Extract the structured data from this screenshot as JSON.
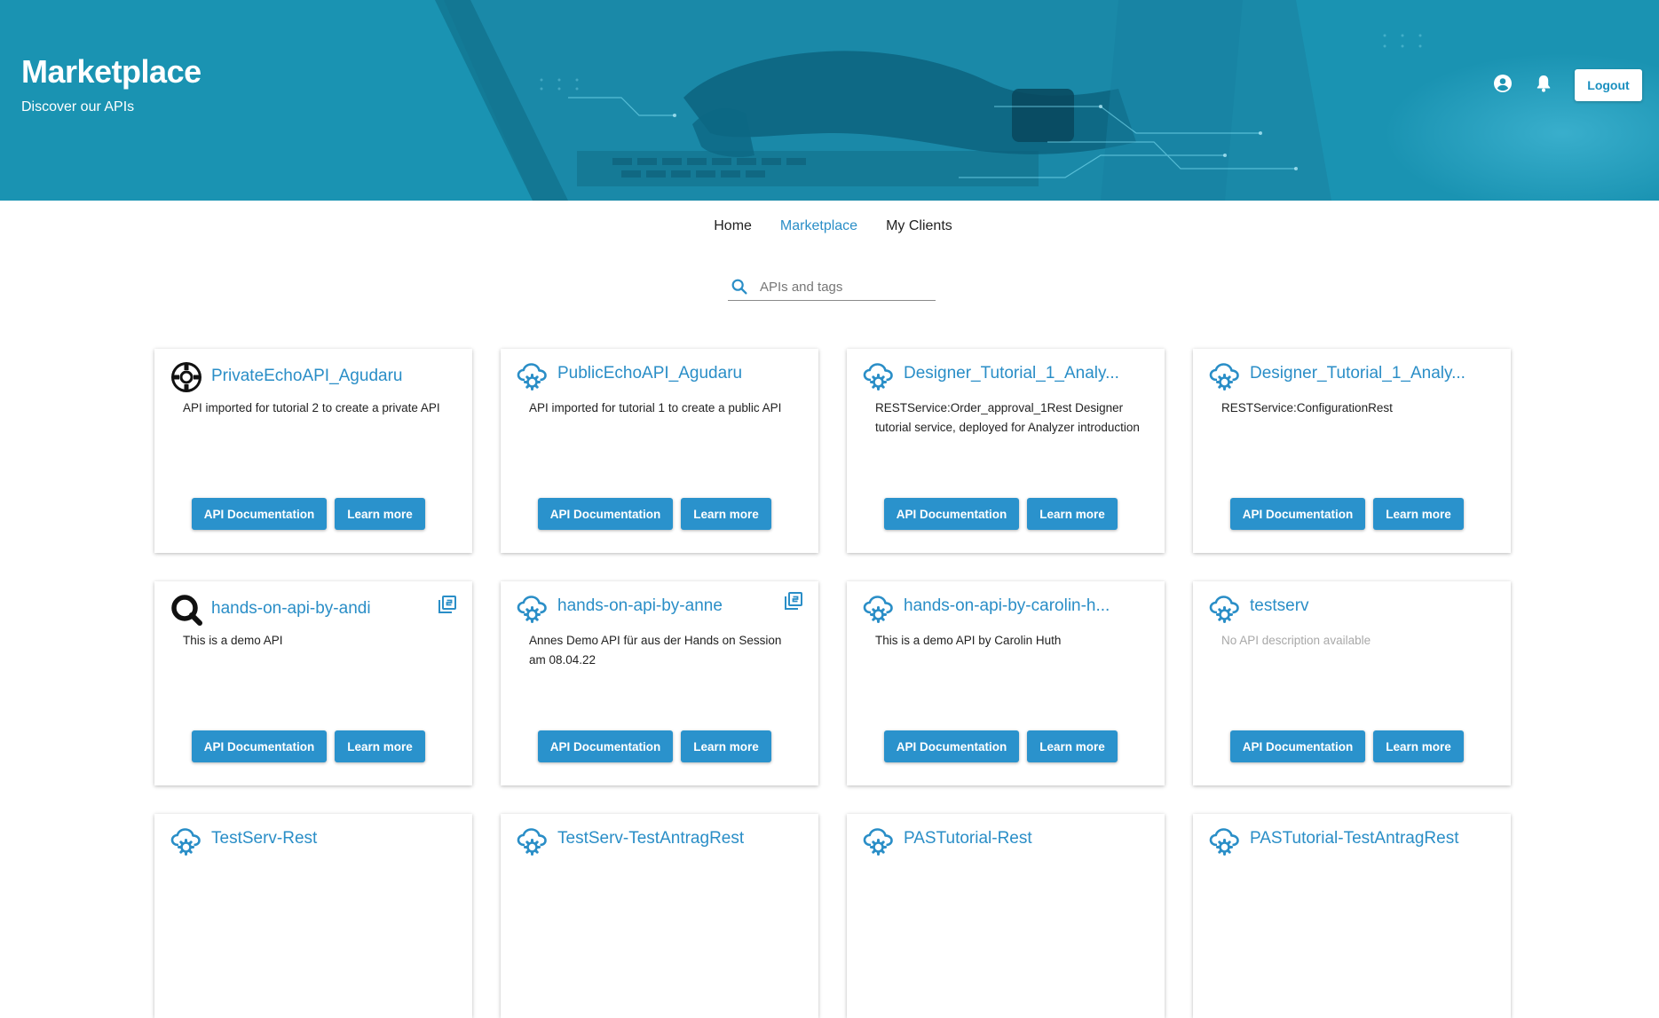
{
  "header": {
    "title": "Marketplace",
    "subtitle": "Discover our APIs",
    "logout_label": "Logout",
    "icons": [
      "account-circle-icon",
      "bell-icon"
    ]
  },
  "nav": {
    "items": [
      "Home",
      "Marketplace",
      "My Clients"
    ],
    "active": "Marketplace"
  },
  "search": {
    "placeholder": "APIs and tags",
    "value": ""
  },
  "buttons": {
    "doc_label": "API Documentation",
    "learn_label": "Learn more"
  },
  "colors": {
    "accent": "#2a8ec7",
    "button": "#2a92cc",
    "hero": "#1a93b2"
  },
  "cards": [
    {
      "title": "PrivateEchoAPI_Agudaru",
      "icon": "lifebuoy-icon",
      "desc": "API imported for tutorial 2 to create a private API",
      "doc_badge": false
    },
    {
      "title": "PublicEchoAPI_Agudaru",
      "icon": "cloud-gear-icon",
      "desc": "API imported for tutorial 1 to create a public API",
      "doc_badge": false
    },
    {
      "title": "Designer_Tutorial_1_Analy...",
      "icon": "cloud-gear-icon",
      "desc": "RESTService:Order_approval_1Rest Designer tutorial service, deployed for Analyzer introduction",
      "doc_badge": false
    },
    {
      "title": "Designer_Tutorial_1_Analy...",
      "icon": "cloud-gear-icon",
      "desc": "RESTService:ConfigurationRest",
      "doc_badge": false
    },
    {
      "title": "hands-on-api-by-andi",
      "icon": "magnifier-logo-icon",
      "desc": "This is a demo API",
      "doc_badge": true
    },
    {
      "title": "hands-on-api-by-anne",
      "icon": "cloud-gear-icon",
      "desc": "Annes Demo API für aus der Hands on Session am 08.04.22",
      "doc_badge": true
    },
    {
      "title": "hands-on-api-by-carolin-h...",
      "icon": "cloud-gear-icon",
      "desc": "This is a demo API by Carolin Huth",
      "doc_badge": false
    },
    {
      "title": "testserv",
      "icon": "cloud-gear-icon",
      "desc": "No API description available",
      "doc_badge": false,
      "muted": true
    },
    {
      "title": "TestServ-Rest",
      "icon": "cloud-gear-icon",
      "desc": "",
      "doc_badge": false
    },
    {
      "title": "TestServ-TestAntragRest",
      "icon": "cloud-gear-icon",
      "desc": "",
      "doc_badge": false
    },
    {
      "title": "PASTutorial-Rest",
      "icon": "cloud-gear-icon",
      "desc": "",
      "doc_badge": false
    },
    {
      "title": "PASTutorial-TestAntragRest",
      "icon": "cloud-gear-icon",
      "desc": "",
      "doc_badge": false
    }
  ]
}
